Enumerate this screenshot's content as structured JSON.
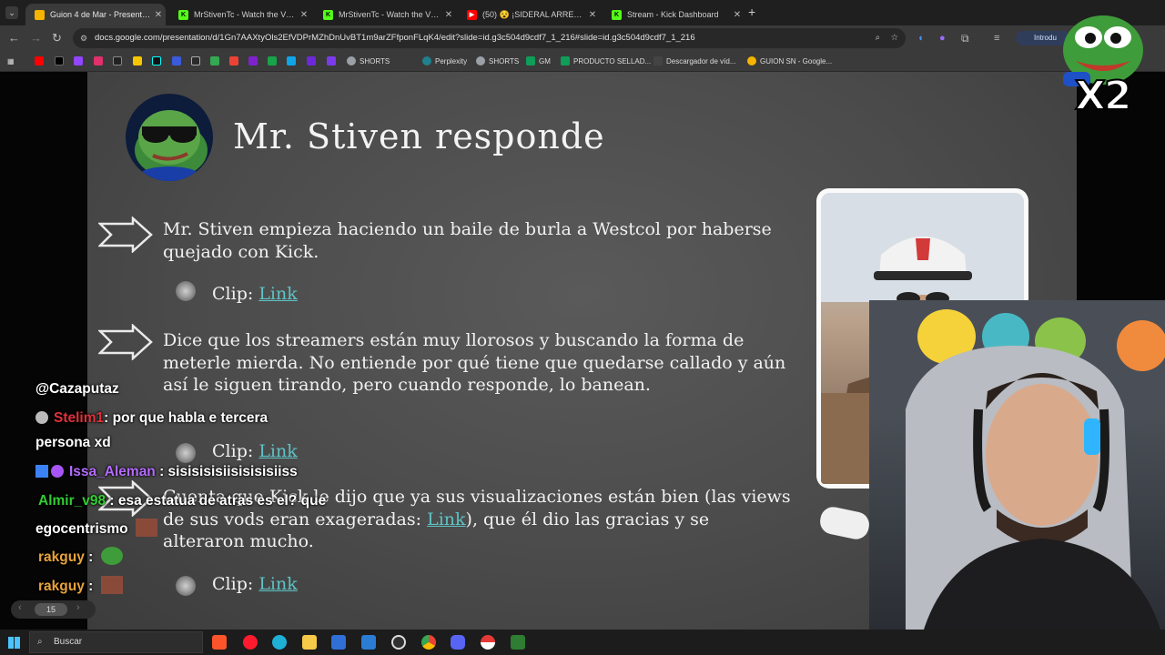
{
  "browser": {
    "tabs": [
      {
        "title": "Guion 4 de Mar - Presentación",
        "icon_color": "#f4b400",
        "active": true
      },
      {
        "title": "MrStivenTc - Watch the VOD o",
        "icon_color": "#53fc18",
        "active": false
      },
      {
        "title": "MrStivenTc - Watch the VOD o",
        "icon_color": "#53fc18",
        "active": false
      },
      {
        "title": "(50) 😵 ¡SIDERAL ARREPENTIDO",
        "icon_color": "#ff0000",
        "active": false
      },
      {
        "title": "Stream - Kick Dashboard",
        "icon_color": "#53fc18",
        "active": false
      }
    ],
    "new_tab": "+",
    "url": "docs.google.com/presentation/d/1Gn7AAXtyOls2EfVDPrMZhDnUvBT1m9arZFfponFLqK4/edit?slide=id.g3c504d9cdf7_1_216#slide=id.g3c504d9cdf7_1_216",
    "profile_label": "Introdu",
    "bookmarks": [
      {
        "label": "SHORTS",
        "color": "#9aa0a6"
      },
      {
        "label": "Perplexity",
        "color": "#20808d"
      },
      {
        "label": "SHORTS",
        "color": "#9aa0a6"
      },
      {
        "label": "GM",
        "color": "#0f9d58"
      },
      {
        "label": "PRODUCTO SELLAD...",
        "color": "#0f9d58"
      },
      {
        "label": "Descargador de víd...",
        "color": "#444444"
      },
      {
        "label": "GUION SN - Google...",
        "color": "#f4b400"
      }
    ]
  },
  "slide": {
    "title": "Mr. Stiven responde",
    "points": [
      {
        "text": "Mr. Stiven empieza haciendo un baile de burla a Westcol por haberse quejado con Kick."
      },
      {
        "text": "Dice que los streamers están muy llorosos y buscando la forma de meterle mierda. No entiende por qué tiene que quedarse callado y aún así le siguen tirando, pero cuando responde, lo banean."
      },
      {
        "text_before": "Cuenta que Kick le dijo que ya sus visualizaciones están bien (las views de sus vods eran exageradas: ",
        "link": "Link",
        "text_after": "), que él dio las gracias y se alteraron mucho."
      }
    ],
    "clip_label": "Clip:",
    "clip_link": "Link"
  },
  "chat": [
    {
      "user": "",
      "message": "@Cazaputaz",
      "user_color": "#ffffff"
    },
    {
      "user": "Stelim1",
      "message": ": por que habla e tercera",
      "user_color": "#e0303a"
    },
    {
      "user": "",
      "message": "persona xd",
      "user_color": "#ffffff"
    },
    {
      "user": "Issa_Aleman",
      "message": ": sisisisisiisisisisiiss",
      "user_color": "#b46bff"
    },
    {
      "user": "Almir_v98",
      "message": ": esa estatua de atras es el? que",
      "user_color": "#32cd32"
    },
    {
      "user": "",
      "message": "egocentrismo",
      "user_color": "#ffffff"
    },
    {
      "user": "rakguy",
      "message": ":",
      "user_color": "#e8a33c"
    },
    {
      "user": "rakguy",
      "message": ":",
      "user_color": "#e8a33c"
    }
  ],
  "overlay": {
    "multiplier": "X2",
    "page_badge": "15"
  },
  "taskbar": {
    "search_placeholder": "Buscar"
  }
}
